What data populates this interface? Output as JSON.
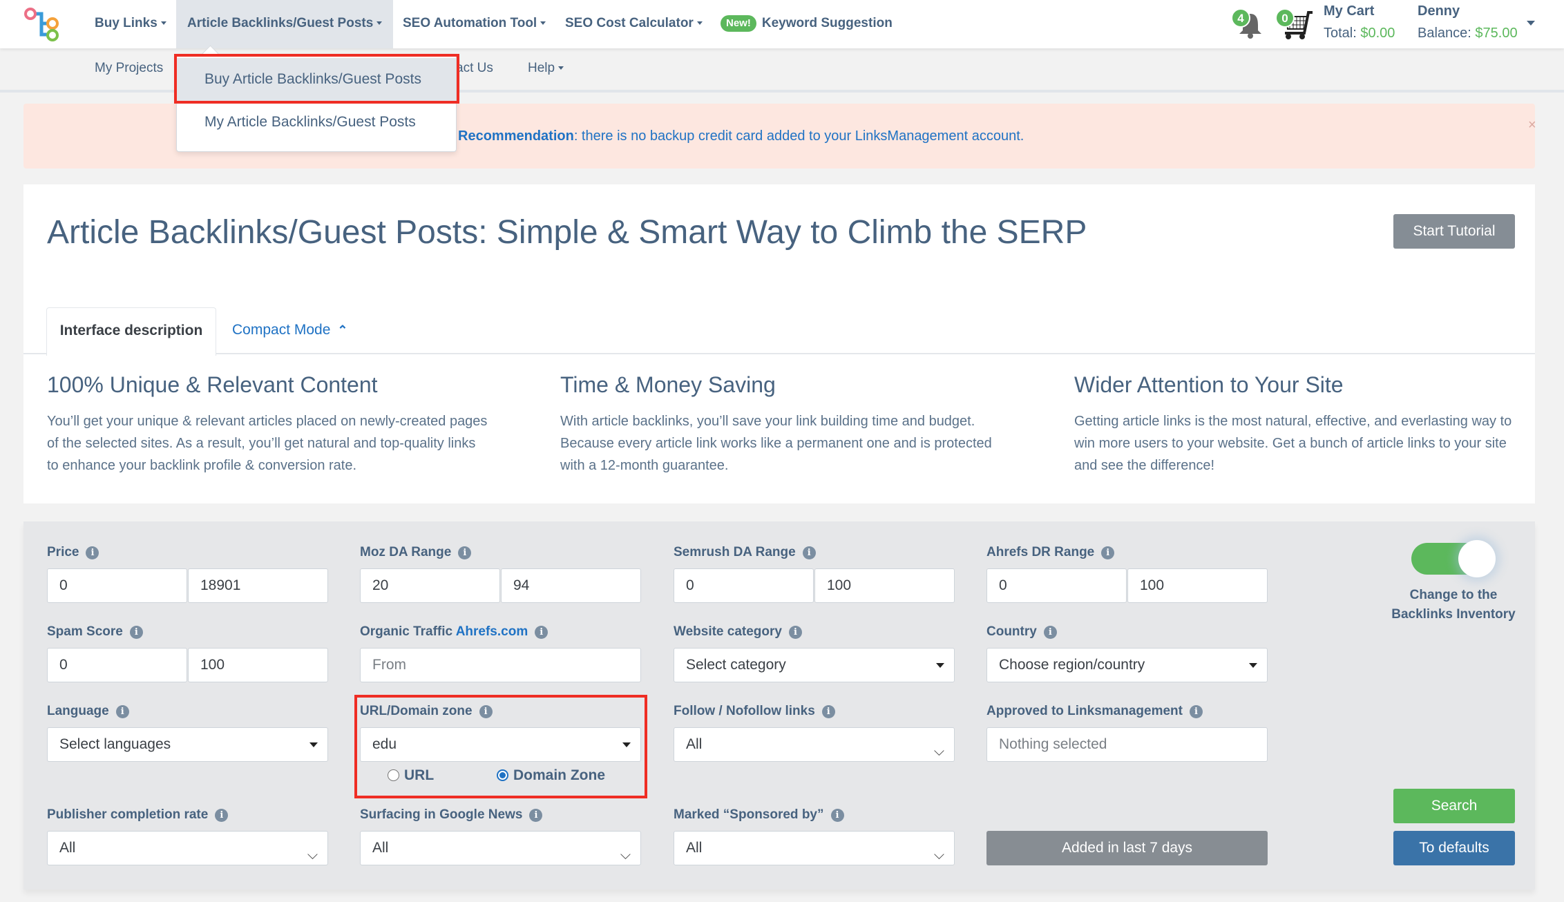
{
  "topnav": {
    "items": [
      {
        "label": "Buy Links",
        "has_caret": true
      },
      {
        "label": "Article Backlinks/Guest Posts",
        "has_caret": true,
        "active": true
      },
      {
        "label": "SEO Automation Tool",
        "has_caret": true
      },
      {
        "label": "SEO Cost Calculator",
        "has_caret": true
      },
      {
        "label": "Keyword Suggestion",
        "badge": "New!"
      }
    ],
    "notifications_count": "4",
    "cart_count": "0",
    "cart_label": "My Cart",
    "cart_total_label": "Total:",
    "cart_total_value": "$0.00",
    "user_name": "Denny",
    "balance_label": "Balance:",
    "balance_value": "$75.00"
  },
  "subnav": {
    "items": [
      "My Projects",
      "act Us",
      "Help"
    ]
  },
  "dropdown": {
    "items": [
      "Buy Article Backlinks/Guest Posts",
      "My Article Backlinks/Guest Posts"
    ]
  },
  "alert": {
    "strong": "Recommendation",
    "text": ": there is no backup credit card added to your LinksManagement account.",
    "close": "×"
  },
  "main": {
    "title": "Article Backlinks/Guest Posts: Simple & Smart Way to Climb the SERP",
    "tutorial_button": "Start Tutorial",
    "tabs": {
      "active": "Interface description",
      "link": "Compact Mode"
    },
    "features": [
      {
        "title": "100% Unique & Relevant Content",
        "text": "You’ll get your unique & relevant articles placed on newly-created pages of the selected sites. As a result, you’ll get natural and top-quality links to enhance your backlink profile & conversion rate."
      },
      {
        "title": "Time & Money Saving",
        "text": "With article backlinks, you’ll save your link building time and budget. Because every article link works like a permanent one and is protected with a 12-month guarantee."
      },
      {
        "title": "Wider Attention to Your Site",
        "text": "Getting article links is the most natural, effective, and everlasting way to win more users to your website. Get a bunch of article links to your site and see the difference!"
      }
    ]
  },
  "filters": {
    "price": {
      "label": "Price",
      "from": "0",
      "to": "18901"
    },
    "moz": {
      "label": "Moz DA Range",
      "from": "20",
      "to": "94"
    },
    "semrush": {
      "label": "Semrush DA Range",
      "from": "0",
      "to": "100"
    },
    "ahrefs": {
      "label": "Ahrefs DR Range",
      "from": "0",
      "to": "100"
    },
    "spam": {
      "label": "Spam Score",
      "from": "0",
      "to": "100"
    },
    "traffic": {
      "label": "Organic Traffic",
      "link": "Ahrefs.com",
      "placeholder": "From"
    },
    "category": {
      "label": "Website category",
      "value": "Select category"
    },
    "country": {
      "label": "Country",
      "value": "Choose region/country"
    },
    "language": {
      "label": "Language",
      "value": "Select languages"
    },
    "zone": {
      "label": "URL/Domain zone",
      "value": "edu",
      "radio_url": "URL",
      "radio_zone": "Domain Zone",
      "selected": "Domain Zone"
    },
    "follow": {
      "label": "Follow / Nofollow links",
      "value": "All"
    },
    "approved": {
      "label": "Approved to Linksmanagement",
      "value": "Nothing selected"
    },
    "completion": {
      "label": "Publisher completion rate",
      "value": "All"
    },
    "news": {
      "label": "Surfacing in Google News",
      "value": "All"
    },
    "sponsored": {
      "label": "Marked “Sponsored by”",
      "value": "All"
    },
    "toggle": {
      "label": "Change to the Backlinks Inventory",
      "on": true
    },
    "added_button": "Added in last 7 days",
    "search_button": "Search",
    "defaults_button": "To defaults"
  }
}
